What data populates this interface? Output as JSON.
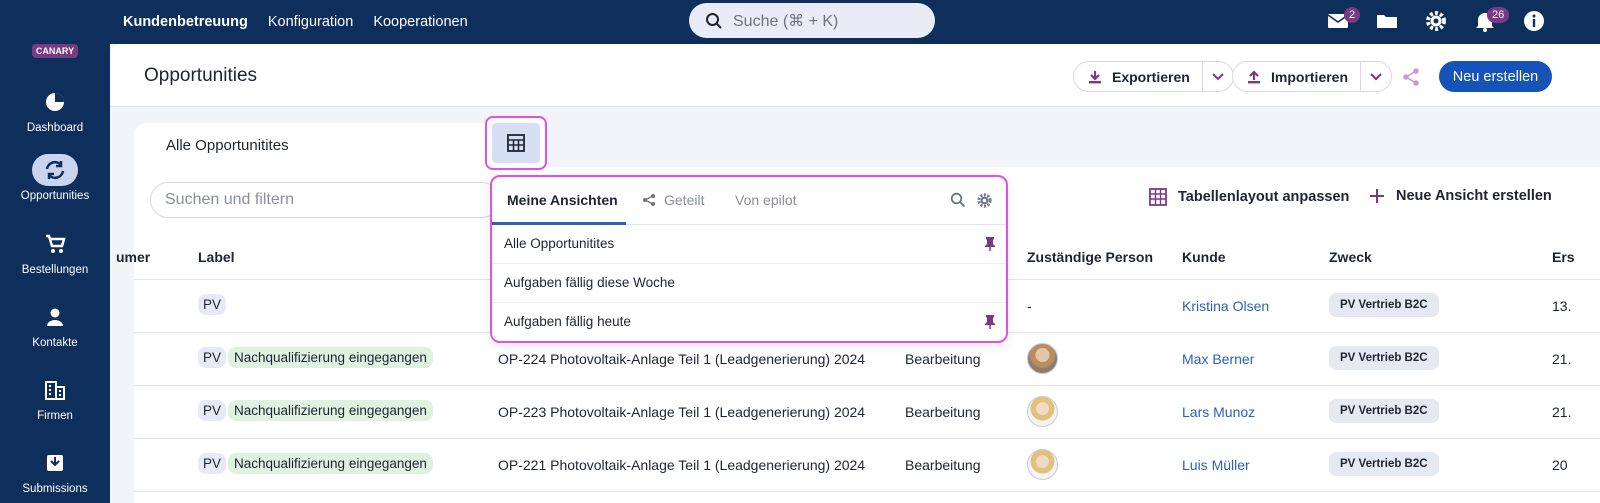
{
  "brand": {
    "logo_text": "CANARY"
  },
  "topnav": [
    "Kundenbetreuung",
    "Konfiguration",
    "Kooperationen"
  ],
  "top_search": {
    "placeholder": "Suche (⌘ + K)"
  },
  "notifications": {
    "mail_count": "2",
    "bell_count": "26"
  },
  "sidebar": [
    {
      "label": "Dashboard",
      "icon": "pie-chart-icon"
    },
    {
      "label": "Opportunities",
      "icon": "refresh-icon",
      "active": true
    },
    {
      "label": "Bestellungen",
      "icon": "cart-icon"
    },
    {
      "label": "Kontakte",
      "icon": "person-icon"
    },
    {
      "label": "Firmen",
      "icon": "building-icon"
    },
    {
      "label": "Submissions",
      "icon": "inbox-icon"
    }
  ],
  "header": {
    "title": "Opportunities",
    "export_label": "Exportieren",
    "import_label": "Importieren",
    "new_label": "Neu erstellen"
  },
  "view_tab": {
    "label": "Alle Opportunitites"
  },
  "filter": {
    "placeholder": "Suchen und filtern"
  },
  "actions": {
    "layout_label": "Tabellenlayout anpassen",
    "new_view_label": "Neue Ansicht erstellen"
  },
  "dropdown": {
    "tabs": [
      "Meine Ansichten",
      "Geteilt",
      "Von epilot"
    ],
    "items": [
      {
        "label": "Alle Opportunitites",
        "pinned": true
      },
      {
        "label": "Aufgaben fällig diese Woche",
        "pinned": false
      },
      {
        "label": "Aufgaben fällig heute",
        "pinned": true
      }
    ]
  },
  "table": {
    "headers": [
      "umer",
      "Label",
      "Zuständige Person",
      "Kunde",
      "Zweck",
      "Ers"
    ],
    "rows": [
      {
        "pv": "PV",
        "tag": "",
        "title": "",
        "status": "",
        "person": "-",
        "kunde": "Kristina Olsen",
        "zweck": "PV Vertrieb B2C",
        "date": "13."
      },
      {
        "pv": "PV",
        "tag": "Nachqualifizierung eingegangen",
        "title": "OP-224 Photovoltaik-Anlage Teil 1 (Leadgenerierung) 2024",
        "status": "Bearbeitung",
        "person": "",
        "kunde": "Max Berner",
        "zweck": "PV Vertrieb B2C",
        "date": "21."
      },
      {
        "pv": "PV",
        "tag": "Nachqualifizierung eingegangen",
        "title": "OP-223 Photovoltaik-Anlage Teil 1 (Leadgenerierung) 2024",
        "status": "Bearbeitung",
        "person": "",
        "kunde": "Lars Munoz",
        "zweck": "PV Vertrieb B2C",
        "date": "21."
      },
      {
        "pv": "PV",
        "tag": "Nachqualifizierung eingegangen",
        "title": "OP-221 Photovoltaik-Anlage Teil 1 (Leadgenerierung) 2024",
        "status": "Bearbeitung",
        "person": "",
        "kunde": "Luis Müller",
        "zweck": "PV Vertrieb B2C",
        "date": "20"
      }
    ]
  }
}
